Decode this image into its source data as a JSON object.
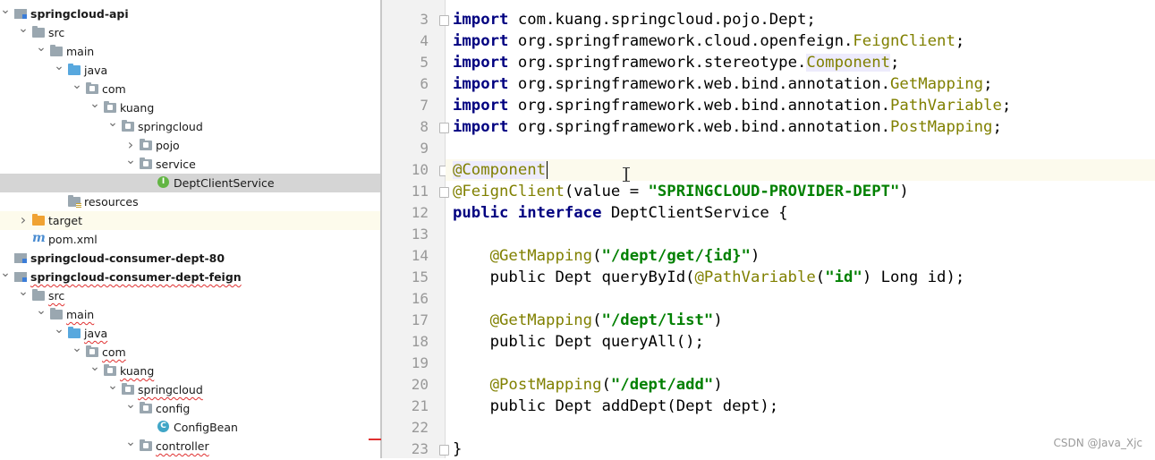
{
  "project_tree": [
    {
      "label": "springcloud-api",
      "depth": 0,
      "arrow": "down",
      "icon": "module-icon",
      "bold": true
    },
    {
      "label": "src",
      "depth": 1,
      "arrow": "down",
      "icon": "folder-icon"
    },
    {
      "label": "main",
      "depth": 2,
      "arrow": "down",
      "icon": "folder-icon"
    },
    {
      "label": "java",
      "depth": 3,
      "arrow": "down",
      "icon": "source-folder-icon"
    },
    {
      "label": "com",
      "depth": 4,
      "arrow": "down",
      "icon": "package-icon"
    },
    {
      "label": "kuang",
      "depth": 5,
      "arrow": "down",
      "icon": "package-icon"
    },
    {
      "label": "springcloud",
      "depth": 6,
      "arrow": "down",
      "icon": "package-icon"
    },
    {
      "label": "pojo",
      "depth": 7,
      "arrow": "right",
      "icon": "package-icon"
    },
    {
      "label": "service",
      "depth": 7,
      "arrow": "down",
      "icon": "package-icon"
    },
    {
      "label": "DeptClientService",
      "depth": 8,
      "arrow": "none",
      "icon": "interface-icon",
      "selected": true
    },
    {
      "label": "resources",
      "depth": 3,
      "arrow": "none",
      "icon": "resources-folder-icon"
    },
    {
      "label": "target",
      "depth": 1,
      "arrow": "right",
      "icon": "target-folder-icon",
      "highlight": true
    },
    {
      "label": "pom.xml",
      "depth": 1,
      "arrow": "none",
      "icon": "maven-icon"
    },
    {
      "label": "springcloud-consumer-dept-80",
      "depth": 0,
      "arrow": "none",
      "icon": "module-icon",
      "bold": true
    },
    {
      "label": "springcloud-consumer-dept-feign",
      "depth": 0,
      "arrow": "down",
      "icon": "module-icon",
      "bold": true,
      "squiggle": true
    },
    {
      "label": "src",
      "depth": 1,
      "arrow": "down",
      "icon": "folder-icon",
      "squiggle": true
    },
    {
      "label": "main",
      "depth": 2,
      "arrow": "down",
      "icon": "folder-icon",
      "squiggle": true
    },
    {
      "label": "java",
      "depth": 3,
      "arrow": "down",
      "icon": "source-folder-icon",
      "squiggle": true
    },
    {
      "label": "com",
      "depth": 4,
      "arrow": "down",
      "icon": "package-icon",
      "squiggle": true
    },
    {
      "label": "kuang",
      "depth": 5,
      "arrow": "down",
      "icon": "package-icon",
      "squiggle": true
    },
    {
      "label": "springcloud",
      "depth": 6,
      "arrow": "down",
      "icon": "package-icon",
      "squiggle": true
    },
    {
      "label": "config",
      "depth": 7,
      "arrow": "down",
      "icon": "package-icon"
    },
    {
      "label": "ConfigBean",
      "depth": 8,
      "arrow": "none",
      "icon": "class-icon"
    },
    {
      "label": "controller",
      "depth": 7,
      "arrow": "down",
      "icon": "package-icon",
      "squiggle": true
    }
  ],
  "editor": {
    "current_line": 10,
    "lines": [
      {
        "n": 3,
        "fold": true,
        "tokens": [
          [
            "kw",
            "import"
          ],
          [
            "",
            "com.kuang.springcloud.pojo.Dept;"
          ]
        ]
      },
      {
        "n": 4,
        "tokens": [
          [
            "kw",
            "import"
          ],
          [
            "",
            "org.springframework.cloud.openfeign."
          ],
          [
            "ty",
            "FeignClient"
          ],
          [
            "",
            ";"
          ]
        ]
      },
      {
        "n": 5,
        "tokens": [
          [
            "kw",
            "import"
          ],
          [
            "",
            "org.springframework.stereotype."
          ],
          [
            "tyhl",
            "Component"
          ],
          [
            "",
            ";"
          ]
        ]
      },
      {
        "n": 6,
        "tokens": [
          [
            "kw",
            "import"
          ],
          [
            "",
            "org.springframework.web.bind.annotation."
          ],
          [
            "ty",
            "GetMapping"
          ],
          [
            "",
            ";"
          ]
        ]
      },
      {
        "n": 7,
        "tokens": [
          [
            "kw",
            "import"
          ],
          [
            "",
            "org.springframework.web.bind.annotation."
          ],
          [
            "ty",
            "PathVariable"
          ],
          [
            "",
            ";"
          ]
        ]
      },
      {
        "n": 8,
        "fold": true,
        "tokens": [
          [
            "kw",
            "import"
          ],
          [
            "",
            "org.springframework.web.bind.annotation."
          ],
          [
            "ty",
            "PostMapping"
          ],
          [
            "",
            ";"
          ]
        ]
      },
      {
        "n": 9,
        "tokens": []
      },
      {
        "n": 10,
        "fold": true,
        "tokens": [
          [
            "annhl",
            "@Component"
          ],
          [
            "caret",
            ""
          ]
        ]
      },
      {
        "n": 11,
        "fold": true,
        "tokens": [
          [
            "ann",
            "@FeignClient"
          ],
          [
            "",
            "(value = "
          ],
          [
            "str",
            "\"SPRINGCLOUD-PROVIDER-DEPT\""
          ],
          [
            "",
            ")"
          ]
        ]
      },
      {
        "n": 12,
        "tokens": [
          [
            "kw",
            "public"
          ],
          [
            "kw",
            "interface"
          ],
          [
            "",
            "DeptClientService {"
          ]
        ]
      },
      {
        "n": 13,
        "tokens": []
      },
      {
        "n": 14,
        "tokens": [
          [
            "",
            "    "
          ],
          [
            "ann",
            "@GetMapping"
          ],
          [
            "",
            "("
          ],
          [
            "str",
            "\"/dept/get/{id}\""
          ],
          [
            "",
            ")"
          ]
        ]
      },
      {
        "n": 15,
        "tokens": [
          [
            "",
            "    public Dept queryById("
          ],
          [
            "ann",
            "@PathVariable"
          ],
          [
            "",
            "("
          ],
          [
            "str",
            "\"id\""
          ],
          [
            "",
            ") Long id);"
          ]
        ]
      },
      {
        "n": 16,
        "tokens": []
      },
      {
        "n": 17,
        "tokens": [
          [
            "",
            "    "
          ],
          [
            "ann",
            "@GetMapping"
          ],
          [
            "",
            "("
          ],
          [
            "str",
            "\"/dept/list\""
          ],
          [
            "",
            ")"
          ]
        ]
      },
      {
        "n": 18,
        "tokens": [
          [
            "",
            "    public Dept queryAll();"
          ]
        ]
      },
      {
        "n": 19,
        "tokens": []
      },
      {
        "n": 20,
        "tokens": [
          [
            "",
            "    "
          ],
          [
            "ann",
            "@PostMapping"
          ],
          [
            "",
            "("
          ],
          [
            "str",
            "\"/dept/add\""
          ],
          [
            "",
            ")"
          ]
        ]
      },
      {
        "n": 21,
        "tokens": [
          [
            "",
            "    public Dept addDept(Dept dept);"
          ]
        ]
      },
      {
        "n": 22,
        "tokens": []
      },
      {
        "n": 23,
        "fold": true,
        "tokens": [
          [
            "",
            "}"
          ]
        ]
      }
    ]
  },
  "watermark": "CSDN @Java_Xjc"
}
